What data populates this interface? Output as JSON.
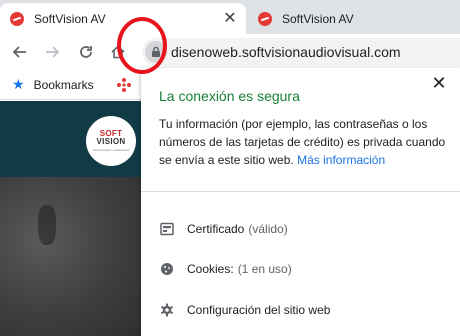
{
  "tabs": [
    {
      "title": "SoftVision AV",
      "close": "✕"
    },
    {
      "title": "SoftVision AV"
    }
  ],
  "toolbar": {
    "url": "disenoweb.softvisionaudiovisual.com"
  },
  "bookmarks": {
    "label": "Bookmarks",
    "star_icon": "★"
  },
  "site": {
    "logo_line1": "SOFT",
    "logo_line2": "VISION",
    "logo_sub": "comunicación • audiovisual"
  },
  "bubble": {
    "close": "✕",
    "title": "La conexión es segura",
    "description": "Tu información (por ejemplo, las contraseñas o los números de las tarjetas de crédito) es privada cuando se envía a este sitio web.",
    "more_info": "Más información",
    "rows": [
      {
        "label": "Certificado",
        "detail": "(válido)",
        "icon": "certificate-icon"
      },
      {
        "label": "Cookies:",
        "detail": "(1 en uso)",
        "icon": "cookie-icon"
      },
      {
        "label": "Configuración del sitio web",
        "detail": "",
        "icon": "settings-gear-icon"
      }
    ]
  },
  "colors": {
    "secure_green": "#188038",
    "link_blue": "#1a73e8",
    "annotation_red": "#e8141c",
    "site_header": "#103a44"
  }
}
